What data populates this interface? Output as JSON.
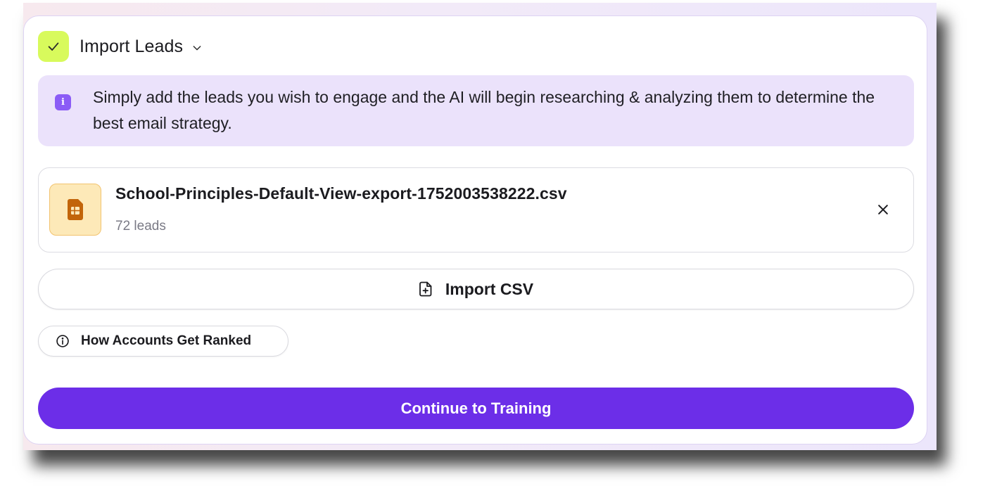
{
  "header": {
    "title": "Import Leads"
  },
  "info": {
    "text": "Simply add the leads you wish to engage and the AI will begin researching & analyzing them to determine the best email strategy."
  },
  "file": {
    "name": "School-Principles-Default-View-export-1752003538222.csv",
    "count": "72 leads"
  },
  "actions": {
    "import_csv": "Import CSV",
    "how_ranked": "How Accounts Get Ranked",
    "continue": "Continue to Training"
  },
  "colors": {
    "accent": "#6c2ee8",
    "check_badge": "#d8fa5c",
    "info_bg": "#ebe2fb",
    "info_icon": "#8b5cf6",
    "file_icon_bg": "#fde9b8",
    "file_icon_fg": "#c2650a"
  },
  "icons": {
    "status": "check-icon",
    "toggle": "chevron-down-icon",
    "info": "info-icon",
    "file": "spreadsheet-file-icon",
    "remove": "close-icon",
    "import": "file-plus-icon",
    "ranked": "info-circle-icon"
  }
}
